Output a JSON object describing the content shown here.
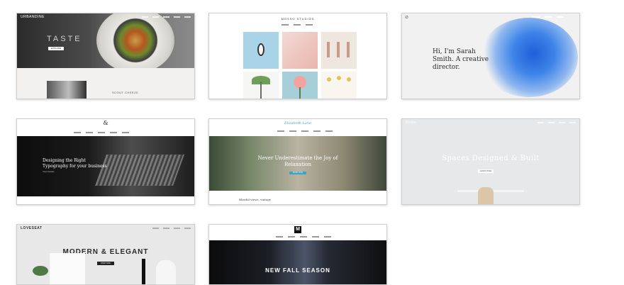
{
  "templates": [
    {
      "brand": "URBANDINE",
      "hero_word": "TASTE",
      "hero_button": "EXPLORE",
      "footer_text": "SCOUT CHEEZE"
    },
    {
      "brand": "MOSSO STUDIOS"
    },
    {
      "headline": "Hi, I'm Sarah Smith. A creative director."
    },
    {
      "logo": "&",
      "headline": "Designing the Right Typography for your business",
      "sub": "View Details"
    },
    {
      "brand": "Elizabeth Lane",
      "headline": "Never Underestimate the Joy of Relaxation",
      "button": "BOOK NOW",
      "footer_text": "Blissful views, vintage"
    },
    {
      "brand": "Home",
      "headline": "Spaces Designed & Built",
      "button": "LEARN MORE"
    },
    {
      "brand": "LOVESEAT",
      "headline": "MODERN & ELEGANT",
      "button": "SHOP NOW"
    },
    {
      "logo": "M",
      "headline": "NEW FALL SEASON"
    }
  ]
}
